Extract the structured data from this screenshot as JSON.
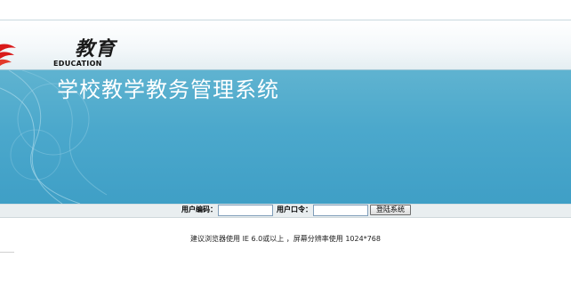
{
  "logo": {
    "cn_text": "教育",
    "en_text": "EDUCATION"
  },
  "banner": {
    "title": "学校教学教务管理系统"
  },
  "login": {
    "user_code_label": "用户编码：",
    "user_code_value": "",
    "password_label": "用户口令：",
    "password_value": "",
    "submit_label": "登陆系统"
  },
  "footer": {
    "note": "建议浏览器使用 IE 6.0或以上 ，屏幕分辨率使用 1024*768"
  },
  "colors": {
    "banner_blue": "#4ba8cc",
    "logo_red": "#d91a1a",
    "header_border": "#9ec6d6"
  }
}
